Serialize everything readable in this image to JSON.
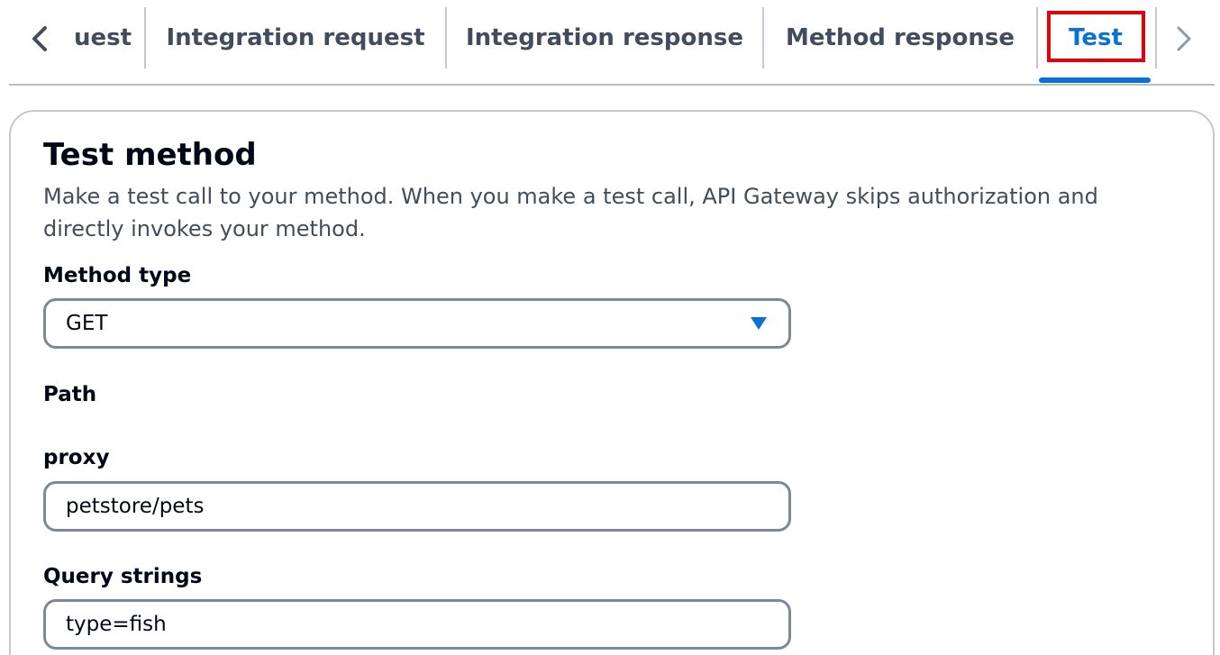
{
  "tabs": {
    "partial_label": "uest",
    "integration_request": "Integration request",
    "integration_response": "Integration response",
    "method_response": "Method response",
    "test": "Test",
    "prev_icon": "chevron-left-icon",
    "next_icon": "chevron-right-icon",
    "active_color": "#0972d3",
    "highlight_color": "#e5000e"
  },
  "panel": {
    "title": "Test method",
    "description": "Make a test call to your method. When you make a test call, API Gateway skips authorization and directly invokes your method."
  },
  "form": {
    "method_type": {
      "label": "Method type",
      "value": "GET",
      "icon": "caret-down-icon"
    },
    "path": {
      "label": "Path"
    },
    "proxy": {
      "label": "proxy",
      "value": "petstore/pets"
    },
    "query_strings": {
      "label": "Query strings",
      "value": "type=fish"
    }
  }
}
